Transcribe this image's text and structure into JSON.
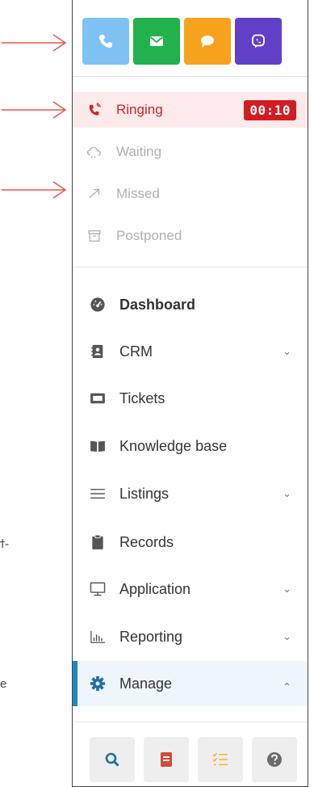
{
  "channels": [
    {
      "name": "phone-icon",
      "color": "#7ec2f3"
    },
    {
      "name": "mail-icon",
      "color": "#22b14c"
    },
    {
      "name": "chat-icon",
      "color": "#f7a21d"
    },
    {
      "name": "viber-icon",
      "color": "#6140c8"
    }
  ],
  "status": {
    "ringing": {
      "label": "Ringing",
      "timer": "00:10"
    },
    "waiting": {
      "label": "Waiting"
    },
    "missed": {
      "label": "Missed"
    },
    "postponed": {
      "label": "Postponed"
    }
  },
  "nav": [
    {
      "label": "Dashboard",
      "icon": "dashboard-icon"
    },
    {
      "label": "CRM",
      "icon": "contacts-icon"
    },
    {
      "label": "Tickets",
      "icon": "ticket-icon"
    },
    {
      "label": "Knowledge base",
      "icon": "book-icon"
    },
    {
      "label": "Listings",
      "icon": "list-icon"
    },
    {
      "label": "Records",
      "icon": "clipboard-icon"
    },
    {
      "label": "Application",
      "icon": "monitor-icon"
    },
    {
      "label": "Reporting",
      "icon": "bar-chart-icon"
    },
    {
      "label": "Manage",
      "icon": "gear-icon"
    }
  ],
  "footer": [
    {
      "icon": "search-icon"
    },
    {
      "icon": "notebook-icon"
    },
    {
      "icon": "checklist-icon"
    },
    {
      "icon": "help-icon"
    }
  ],
  "margin_text": [
    "ϯ-",
    "e"
  ],
  "colors": {
    "accent": "#1f86c8",
    "ringing": "#c9262a",
    "annotation": "#e35a4b"
  }
}
